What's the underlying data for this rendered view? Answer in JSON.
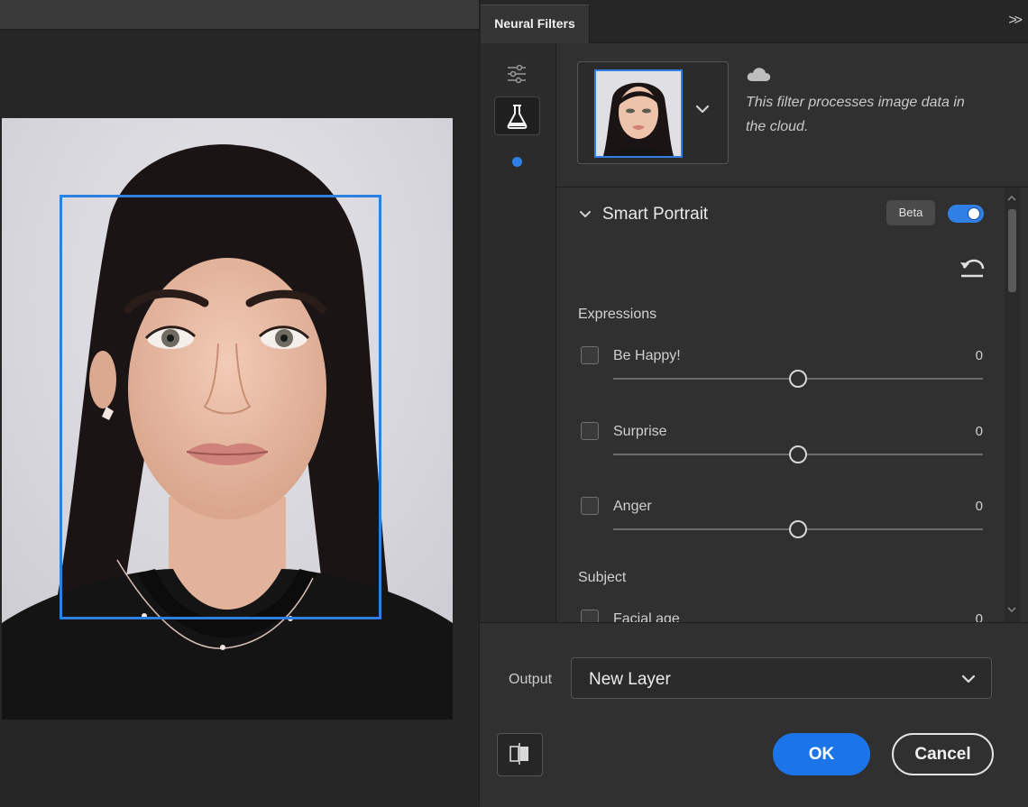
{
  "panel": {
    "tab_label": "Neural Filters",
    "collapse_label": ">>",
    "cloud_notice": "This filter processes image data in the cloud."
  },
  "filter": {
    "name": "Smart Portrait",
    "badge": "Beta",
    "enabled": true,
    "sections": [
      {
        "label": "Expressions",
        "sliders": [
          {
            "name": "Be Happy!",
            "value": "0"
          },
          {
            "name": "Surprise",
            "value": "0"
          },
          {
            "name": "Anger",
            "value": "0"
          }
        ]
      },
      {
        "label": "Subject",
        "sliders": [
          {
            "name": "Facial age",
            "value": "0"
          }
        ]
      }
    ]
  },
  "output": {
    "label": "Output",
    "value": "New Layer"
  },
  "buttons": {
    "ok": "OK",
    "cancel": "Cancel"
  },
  "colors": {
    "accent": "#1b74e8",
    "face_box": "#2d7fe0",
    "panel_bg": "#303030"
  },
  "icons": [
    "sliders-icon",
    "flask-icon",
    "cloud-icon",
    "chevron-down-icon",
    "reset-icon",
    "compare-icon"
  ]
}
